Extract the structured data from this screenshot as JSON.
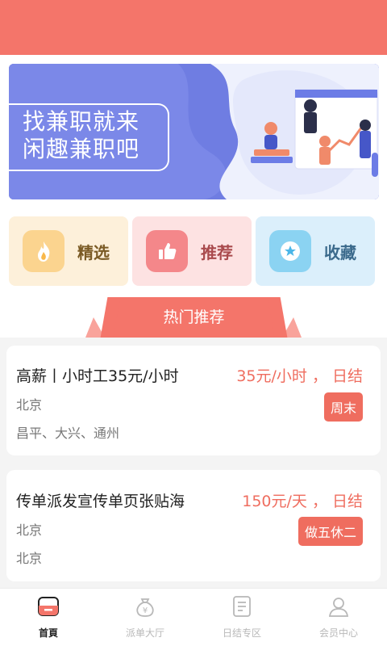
{
  "banner": {
    "line1": "找兼职就来",
    "line2": "闲趣兼职吧"
  },
  "quick_actions": [
    {
      "label": "精选",
      "icon": "flame-icon"
    },
    {
      "label": "推荐",
      "icon": "thumbs-up-icon"
    },
    {
      "label": "收藏",
      "icon": "star-icon"
    }
  ],
  "section_title": "热门推荐",
  "jobs": [
    {
      "title": "高薪丨小时工35元/小时",
      "price": "35元/小时 ， 日结",
      "city": "北京",
      "area": "昌平、大兴、通州",
      "tag": "周末"
    },
    {
      "title": "传单派发宣传单页张贴海",
      "price": "150元/天 ， 日结",
      "city": "北京",
      "area": "北京",
      "tag": "做五休二"
    }
  ],
  "tabs": [
    {
      "label": "首頁",
      "icon": "home-icon",
      "active": true
    },
    {
      "label": "派单大厅",
      "icon": "money-bag-icon",
      "active": false
    },
    {
      "label": "日结专区",
      "icon": "document-icon",
      "active": false
    },
    {
      "label": "会员中心",
      "icon": "user-icon",
      "active": false
    }
  ],
  "colors": {
    "primary": "#f4756a",
    "price": "#ef6d5f",
    "banner": "#6f7de2"
  }
}
